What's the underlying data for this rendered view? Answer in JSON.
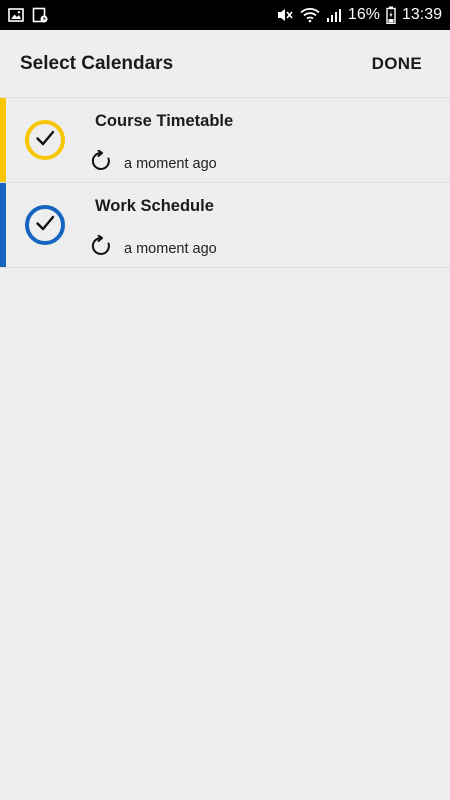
{
  "status_bar": {
    "battery_percent": "16%",
    "time": "13:39"
  },
  "header": {
    "title": "Select Calendars",
    "done_label": "DONE"
  },
  "calendars": [
    {
      "name": "Course Timetable",
      "sync_status": "a moment ago",
      "color": "#f7c600",
      "checked": true
    },
    {
      "name": "Work Schedule",
      "sync_status": "a moment ago",
      "color": "#1565c0",
      "checked": true
    }
  ],
  "icons": {
    "status_left": [
      "image-icon",
      "calendar-notification-icon"
    ],
    "status_right": [
      "mute-icon",
      "wifi-icon",
      "signal-icon",
      "battery-icon"
    ],
    "row": [
      "check-icon",
      "sync-icon"
    ]
  }
}
